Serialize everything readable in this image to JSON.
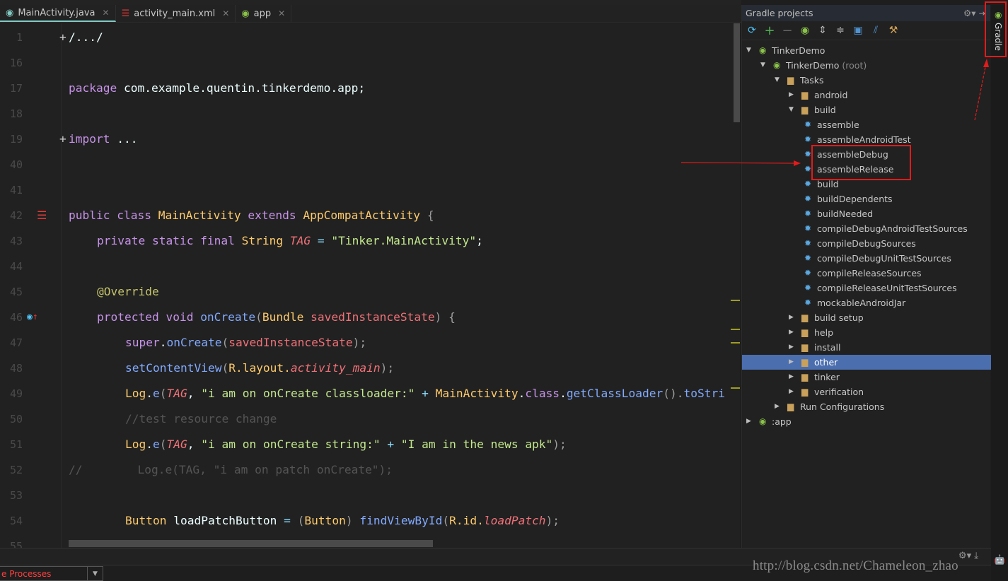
{
  "tabs": [
    {
      "label": "MainActivity.java",
      "icon": "java-class-icon",
      "active": true
    },
    {
      "label": "activity_main.xml",
      "icon": "layout-xml-icon"
    },
    {
      "label": "app",
      "icon": "gradle-icon"
    }
  ],
  "code": [
    {
      "n": "1",
      "fold": "+",
      "t": [
        [
          "/.../",
          "pl"
        ]
      ]
    },
    {
      "n": "16",
      "t": []
    },
    {
      "n": "17",
      "t": [
        [
          "package ",
          "kw"
        ],
        [
          "com.example.quentin.tinkerdemo.app",
          "pl"
        ],
        [
          ";",
          "pl"
        ]
      ]
    },
    {
      "n": "18",
      "t": []
    },
    {
      "n": "19",
      "fold": "+",
      "t": [
        [
          "import ",
          "kw"
        ],
        [
          "...",
          "pl"
        ]
      ]
    },
    {
      "n": "40",
      "t": []
    },
    {
      "n": "41",
      "t": []
    },
    {
      "n": "42",
      "t": [
        [
          "public class ",
          "kw"
        ],
        [
          "MainActivity ",
          "cls"
        ],
        [
          "extends ",
          "kw"
        ],
        [
          "AppCompatActivity ",
          "cls"
        ],
        [
          "{",
          "gr"
        ]
      ]
    },
    {
      "n": "43",
      "i": 1,
      "t": [
        [
          "private static final ",
          "kw"
        ],
        [
          "String ",
          "cls"
        ],
        [
          "TAG",
          "it"
        ],
        [
          " = ",
          "pn"
        ],
        [
          "\"Tinker.MainActivity\"",
          "str"
        ],
        [
          ";",
          "pl"
        ]
      ]
    },
    {
      "n": "44",
      "t": []
    },
    {
      "n": "45",
      "i": 1,
      "t": [
        [
          "@Override",
          "an"
        ]
      ]
    },
    {
      "n": "46",
      "i": 1,
      "t": [
        [
          "protected void ",
          "kw"
        ],
        [
          "onCreate",
          "fn"
        ],
        [
          "(",
          "gr"
        ],
        [
          "Bundle ",
          "cls"
        ],
        [
          "savedInstanceState",
          "par"
        ],
        [
          ") {",
          "gr"
        ]
      ]
    },
    {
      "n": "47",
      "i": 2,
      "t": [
        [
          "super",
          "kw"
        ],
        [
          ".",
          "pl"
        ],
        [
          "onCreate",
          "fn"
        ],
        [
          "(",
          "gr"
        ],
        [
          "savedInstanceState",
          "par"
        ],
        [
          ");",
          "gr"
        ]
      ]
    },
    {
      "n": "48",
      "i": 2,
      "t": [
        [
          "setContentView",
          "fn"
        ],
        [
          "(",
          "gr"
        ],
        [
          "R.layout.",
          "cls"
        ],
        [
          "activity_main",
          "it"
        ],
        [
          ");",
          "gr"
        ]
      ]
    },
    {
      "n": "49",
      "i": 2,
      "t": [
        [
          "Log",
          "cls"
        ],
        [
          ".",
          "pl"
        ],
        [
          "e",
          "fn"
        ],
        [
          "(",
          "gr"
        ],
        [
          "TAG",
          "it"
        ],
        [
          ", ",
          "pl"
        ],
        [
          "\"i am on onCreate classloader:\"",
          "str"
        ],
        [
          " + ",
          "pn"
        ],
        [
          "MainActivity",
          "cls"
        ],
        [
          ".",
          "pl"
        ],
        [
          "class",
          "kw"
        ],
        [
          ".",
          "pl"
        ],
        [
          "getClassLoader",
          "fn"
        ],
        [
          "().",
          "gr"
        ],
        [
          "toStri",
          "fn"
        ]
      ]
    },
    {
      "n": "50",
      "i": 2,
      "t": [
        [
          "//test resource change",
          "cm"
        ]
      ]
    },
    {
      "n": "51",
      "i": 2,
      "t": [
        [
          "Log",
          "cls"
        ],
        [
          ".",
          "pl"
        ],
        [
          "e",
          "fn"
        ],
        [
          "(",
          "gr"
        ],
        [
          "TAG",
          "it"
        ],
        [
          ", ",
          "pl"
        ],
        [
          "\"i am on onCreate string:\"",
          "str"
        ],
        [
          " + ",
          "pn"
        ],
        [
          "\"I am in the news apk\"",
          "str"
        ],
        [
          ");",
          "gr"
        ]
      ]
    },
    {
      "n": "52",
      "t": [
        [
          "//        Log.e(TAG, \"i am on patch onCreate\");",
          "cm"
        ]
      ]
    },
    {
      "n": "53",
      "t": []
    },
    {
      "n": "54",
      "i": 2,
      "t": [
        [
          "Button ",
          "cls"
        ],
        [
          "loadPatchButton ",
          "pl"
        ],
        [
          "= ",
          "pn"
        ],
        [
          "(",
          "gr"
        ],
        [
          "Button",
          "cls"
        ],
        [
          ") ",
          "gr"
        ],
        [
          "findViewById",
          "fn"
        ],
        [
          "(",
          "gr"
        ],
        [
          "R.id.",
          "cls"
        ],
        [
          "loadPatch",
          "it"
        ],
        [
          ");",
          "gr"
        ]
      ]
    },
    {
      "n": "55",
      "t": []
    }
  ],
  "gradle": {
    "title": "Gradle projects",
    "side_tab": "Gradle",
    "tree": [
      {
        "label": "TinkerDemo",
        "d": 0,
        "tw": "open",
        "icon": "gradle"
      },
      {
        "label": "TinkerDemo",
        "suffix": "(root)",
        "d": 1,
        "tw": "open",
        "icon": "gradle"
      },
      {
        "label": "Tasks",
        "d": 2,
        "tw": "open",
        "icon": "folder"
      },
      {
        "label": "android",
        "d": 3,
        "tw": "closed",
        "icon": "folder"
      },
      {
        "label": "build",
        "d": 3,
        "tw": "open",
        "icon": "folder"
      },
      {
        "label": "assemble",
        "d": 4,
        "icon": "gear"
      },
      {
        "label": "assembleAndroidTest",
        "d": 4,
        "icon": "gear"
      },
      {
        "label": "assembleDebug",
        "d": 4,
        "icon": "gear"
      },
      {
        "label": "assembleRelease",
        "d": 4,
        "icon": "gear"
      },
      {
        "label": "build",
        "d": 4,
        "icon": "gear"
      },
      {
        "label": "buildDependents",
        "d": 4,
        "icon": "gear"
      },
      {
        "label": "buildNeeded",
        "d": 4,
        "icon": "gear"
      },
      {
        "label": "compileDebugAndroidTestSources",
        "d": 4,
        "icon": "gear"
      },
      {
        "label": "compileDebugSources",
        "d": 4,
        "icon": "gear"
      },
      {
        "label": "compileDebugUnitTestSources",
        "d": 4,
        "icon": "gear"
      },
      {
        "label": "compileReleaseSources",
        "d": 4,
        "icon": "gear"
      },
      {
        "label": "compileReleaseUnitTestSources",
        "d": 4,
        "icon": "gear"
      },
      {
        "label": "mockableAndroidJar",
        "d": 4,
        "icon": "gear"
      },
      {
        "label": "build setup",
        "d": 3,
        "tw": "closed",
        "icon": "folder"
      },
      {
        "label": "help",
        "d": 3,
        "tw": "closed",
        "icon": "folder"
      },
      {
        "label": "install",
        "d": 3,
        "tw": "closed",
        "icon": "folder"
      },
      {
        "label": "other",
        "d": 3,
        "tw": "closed",
        "icon": "folder",
        "selected": true
      },
      {
        "label": "tinker",
        "d": 3,
        "tw": "closed",
        "icon": "folder"
      },
      {
        "label": "verification",
        "d": 3,
        "tw": "closed",
        "icon": "folder"
      },
      {
        "label": "Run Configurations",
        "d": 2,
        "tw": "closed",
        "icon": "folder"
      },
      {
        "label": ":app",
        "d": 1,
        "tw": "closed",
        "icon": "gradle",
        "x": -1
      }
    ]
  },
  "bottom": {
    "dropdown": "e Processes"
  },
  "watermark": "http://blog.csdn.net/Chameleon_zhao",
  "colors": {
    "selection": "#4b6eaf",
    "annotation": "#e21b1b",
    "accent": "#80cbc4"
  }
}
